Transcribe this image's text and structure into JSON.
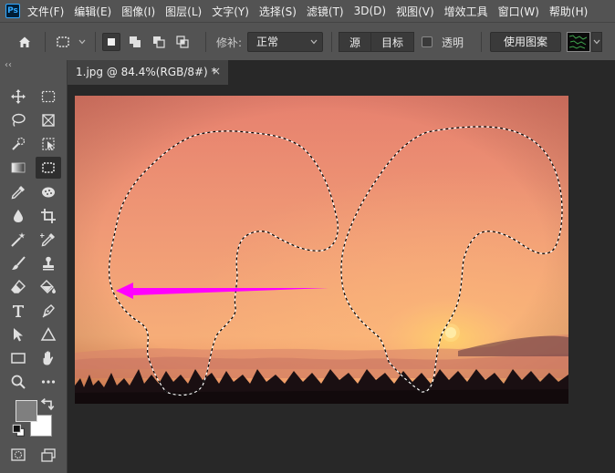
{
  "app": {
    "logo": "Ps"
  },
  "menubar": {
    "items": [
      "文件(F)",
      "编辑(E)",
      "图像(I)",
      "图层(L)",
      "文字(Y)",
      "选择(S)",
      "滤镜(T)",
      "3D(D)",
      "视图(V)",
      "增效工具",
      "窗口(W)",
      "帮助(H)"
    ]
  },
  "options": {
    "patch_label": "修补:",
    "patch_mode": "正常",
    "source_label": "源",
    "target_label": "目标",
    "transparent_label": "透明",
    "use_pattern_label": "使用图案"
  },
  "toolbar": {
    "collapse_glyph": "‹‹"
  },
  "document": {
    "tab_title": "1.jpg @ 84.4%(RGB/8#) *",
    "close_glyph": "×"
  },
  "colors": {
    "foreground": "#7f7f7f",
    "background": "#ffffff",
    "arrow": "#ff00ff",
    "sky_top": "#e8816e",
    "sky_bottom": "#f4a070"
  }
}
